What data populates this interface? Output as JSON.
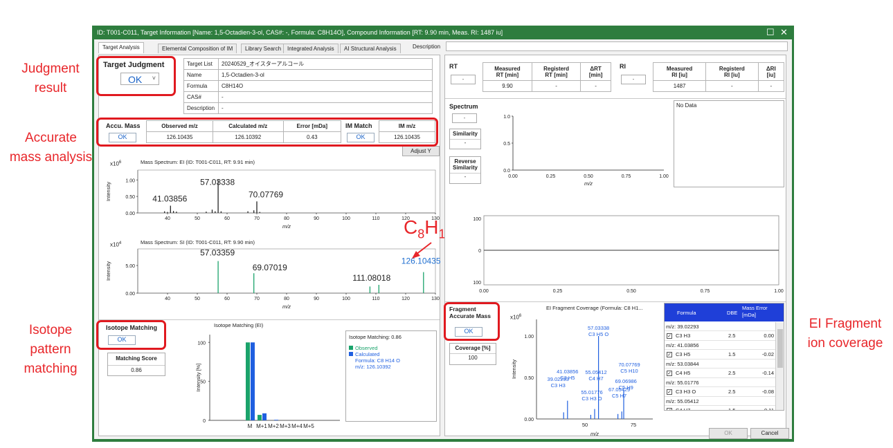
{
  "callouts": {
    "judgment": [
      "Judgment",
      "result"
    ],
    "accurate": [
      "Accurate",
      "mass analysis"
    ],
    "isotope": [
      "Isotope",
      "pattern",
      "matching"
    ],
    "fragment": [
      "EI Fragment",
      "ion coverage"
    ]
  },
  "window": {
    "title": "ID: T001-C011, Target Information [Name: 1,5-Octadien-3-ol, CAS#: -, Formula: C8H14O], Compound Information [RT: 9.90 min, Meas. RI: 1487 iu]",
    "close_glyph": "✕",
    "max_glyph": "☐"
  },
  "tabs": [
    "Target Analysis",
    "Elemental Composition of IM",
    "Library Search",
    "Integrated Analysis",
    "AI Structural Analysis"
  ],
  "description_label": "Description",
  "target_judgment": {
    "label": "Target Judgment",
    "value": "OK",
    "arrow": "˅"
  },
  "target_info": {
    "rows": [
      {
        "k": "Target List",
        "v": "20240529_オイスターアルコール"
      },
      {
        "k": "Name",
        "v": "1,5-Octadien-3-ol"
      },
      {
        "k": "Formula",
        "v": "C8H14O"
      },
      {
        "k": "CAS#",
        "v": "-"
      },
      {
        "k": "Description",
        "v": "-"
      }
    ]
  },
  "accu_mass": {
    "label": "Accu. Mass",
    "status": "OK",
    "headers": [
      "Observed m/z",
      "Calculated m/z",
      "Error [mDa]"
    ],
    "values": [
      "126.10435",
      "126.10392",
      "0.43"
    ],
    "im_label": "IM Match",
    "im_status": "OK",
    "im_header": "IM m/z",
    "im_value": "126.10435",
    "adjust_label": "Adjust Y"
  },
  "ei_spectrum": {
    "title": "Mass Spectrum: EI (ID: T001-C011, RT: 9.91 min)",
    "exp": "x10",
    "exp_power": "6",
    "ylabel": "Intensity",
    "xlabel": "m/z",
    "peak_labels": [
      "57.03338",
      "41.03856",
      "70.07769"
    ]
  },
  "si_spectrum": {
    "title": "Mass Spectrum: SI (ID: T001-C011, RT: 9.90 min)",
    "exp": "x10",
    "exp_power": "4",
    "ylabel": "Intensity",
    "xlabel": "m/z",
    "peak_labels": [
      "57.03359",
      "69.07019",
      "111.08018",
      "126.10435"
    ],
    "formula_big": {
      "c": "C",
      "n8": "8",
      "h": "H",
      "n14": "14",
      "o": "O"
    }
  },
  "chart_data": [
    {
      "type": "bar",
      "name": "Mass Spectrum EI",
      "title": "Mass Spectrum: EI (ID: T001-C011, RT: 9.91 min)",
      "xlabel": "m/z",
      "ylabel": "Intensity",
      "xlim": [
        30,
        130
      ],
      "ylim": [
        0,
        1.3
      ],
      "xticks": [
        40,
        50,
        60,
        70,
        80,
        90,
        100,
        110,
        120,
        130
      ],
      "yticks": [
        0.0,
        0.5,
        1.0
      ],
      "ytick_labels": [
        "0.00",
        "0.50",
        "1.00"
      ],
      "x": [
        39.0,
        40.0,
        41.0,
        42.0,
        43.0,
        53.0,
        55.0,
        56.0,
        57.0,
        58.0,
        67.0,
        69.0,
        70.0,
        71.0
      ],
      "y": [
        0.05,
        0.03,
        0.22,
        0.06,
        0.04,
        0.04,
        0.1,
        0.05,
        1.0,
        0.05,
        0.05,
        0.08,
        0.35,
        0.03
      ]
    },
    {
      "type": "bar",
      "name": "Mass Spectrum SI",
      "title": "Mass Spectrum: SI (ID: T001-C011, RT: 9.90 min)",
      "xlabel": "m/z",
      "ylabel": "Intensity",
      "xlim": [
        30,
        130
      ],
      "ylim": [
        0,
        8
      ],
      "xticks": [
        40,
        50,
        60,
        70,
        80,
        90,
        100,
        110,
        120,
        130
      ],
      "yticks": [
        0.0,
        5.0
      ],
      "ytick_labels": [
        "0.00",
        "5.00"
      ],
      "x": [
        57.0,
        69.0,
        108.0,
        111.0,
        126.0
      ],
      "y": [
        5.8,
        3.6,
        1.2,
        1.5,
        3.8
      ]
    },
    {
      "type": "bar",
      "name": "Isotope Matching (EI)",
      "title": "Isotope Matching (EI)",
      "ylabel": "Intensity [%]",
      "ylim": [
        0,
        110
      ],
      "yticks": [
        0,
        50,
        100
      ],
      "categories": [
        "M",
        "M+1",
        "M+2",
        "M+3",
        "M+4",
        "M+5"
      ],
      "series": [
        {
          "name": "Observed",
          "values": [
            100,
            7,
            0,
            0,
            0,
            0
          ],
          "color": "#1aa36b"
        },
        {
          "name": "Calculated",
          "values": [
            100,
            9,
            0.7,
            0,
            0,
            0
          ],
          "color": "#1f5fe0"
        }
      ]
    },
    {
      "type": "bar",
      "name": "EI Fragment Coverage",
      "title": "EI Fragment Coverage (Formula: C8 H1...",
      "xlabel": "m/z",
      "ylabel": "Intensity",
      "xlim": [
        25,
        85
      ],
      "ylim": [
        0,
        1.2
      ],
      "xticks": [
        50,
        75
      ],
      "yticks": [
        0.0,
        0.5,
        1.0
      ],
      "ytick_labels": [
        "0.00",
        "0.50",
        "1.00"
      ],
      "x": [
        39.0,
        41.0,
        53.0,
        55.0,
        57.0,
        67.0,
        69.0,
        70.0
      ],
      "y": [
        0.08,
        0.22,
        0.05,
        0.12,
        1.0,
        0.06,
        0.09,
        0.35
      ]
    }
  ],
  "isotope": {
    "label": "Isotope Matching",
    "status": "OK",
    "score_label": "Matching Score",
    "score": "0.86",
    "chart_title": "Isotope Matching (EI)",
    "legend_title": "Isotope Matching: 0.86",
    "legend_observed": "Observed",
    "legend_calculated": "Calculated",
    "legend_formula": "Formula: C8 H14 O",
    "legend_mz": "m/z: 126.10392"
  },
  "rt": {
    "label": "RT",
    "value": "-",
    "headers": [
      "Measured\nRT [min]",
      "Registerd\nRT [min]",
      "ΔRT\n[min]"
    ],
    "h1a": "Measured",
    "h1b": "RT [min]",
    "h2a": "Registerd",
    "h2b": "RT [min]",
    "h3a": "ΔRT",
    "h3b": "[min]",
    "values": [
      "9.90",
      "-",
      "-"
    ]
  },
  "ri": {
    "label": "RI",
    "value": "-",
    "h1a": "Measured",
    "h1b": "RI [iu]",
    "h2a": "Registerd",
    "h2b": "RI [iu]",
    "h3a": "ΔRI",
    "h3b": "[iu]",
    "values": [
      "1487",
      "-",
      "-"
    ]
  },
  "spectrum": {
    "label": "Spectrum",
    "value": "-",
    "similarity_label": "Similarity",
    "similarity_value": "-",
    "reverse_label_1": "Reverse",
    "reverse_label_2": "Similarity",
    "reverse_value": "-",
    "no_data": "No Data",
    "xlabel": "m/z",
    "xticks": [
      "0.00",
      "0.25",
      "0.50",
      "0.75",
      "1.00"
    ],
    "yticks": [
      "1.0",
      "0.5",
      "0.0"
    ]
  },
  "mirror": {
    "yticks": [
      "100",
      "0",
      "100"
    ],
    "xticks": [
      "0.00",
      "0.25",
      "0.50",
      "0.75",
      "1.00"
    ]
  },
  "fragment": {
    "label_1": "Fragment",
    "label_2": "Accurate Mass",
    "status": "OK",
    "coverage_label": "Coverage [%]",
    "coverage_value": "100",
    "chart_title": "EI Fragment Coverage (Formula: C8 H1...",
    "exp": "x10",
    "exp_power": "6",
    "ylabel": "Intensity",
    "xlabel": "m/z",
    "peak_labels": [
      {
        "mz": "57.03338",
        "f": "C3 H5 O"
      },
      {
        "mz": "41.03856",
        "f": "C3 H5"
      },
      {
        "mz": "39.02293",
        "f": "C3 H3"
      },
      {
        "mz": "55.05412",
        "f": "C4 H7"
      },
      {
        "mz": "55.01776",
        "f": "C3 H3 O"
      },
      {
        "mz": "70.07769",
        "f": "C5 H10"
      },
      {
        "mz": "69.06986",
        "f": "C5 H9"
      },
      {
        "mz": "67.05429",
        "f": "C5 H7"
      }
    ]
  },
  "frag_table": {
    "headers": [
      "Formula",
      "DBE",
      "Mass Error\n[mDa]"
    ],
    "h_formula": "Formula",
    "h_dbe": "DBE",
    "h_err_1": "Mass Error",
    "h_err_2": "[mDa]",
    "groups": [
      {
        "mz": "m/z: 39.02293",
        "formula": "C3 H3",
        "dbe": "2.5",
        "err": "0.00"
      },
      {
        "mz": "m/z: 41.03856",
        "formula": "C3 H5",
        "dbe": "1.5",
        "err": "-0.02"
      },
      {
        "mz": "m/z: 53.03844",
        "formula": "C4 H5",
        "dbe": "2.5",
        "err": "-0.14"
      },
      {
        "mz": "m/z: 55.01776",
        "formula": "C3 H3 O",
        "dbe": "2.5",
        "err": "-0.08"
      },
      {
        "mz": "m/z: 55.05412",
        "formula": "C4 H7",
        "dbe": "1.5",
        "err": "0.11"
      }
    ]
  },
  "footer": {
    "ok": "OK",
    "cancel": "Cancel"
  }
}
